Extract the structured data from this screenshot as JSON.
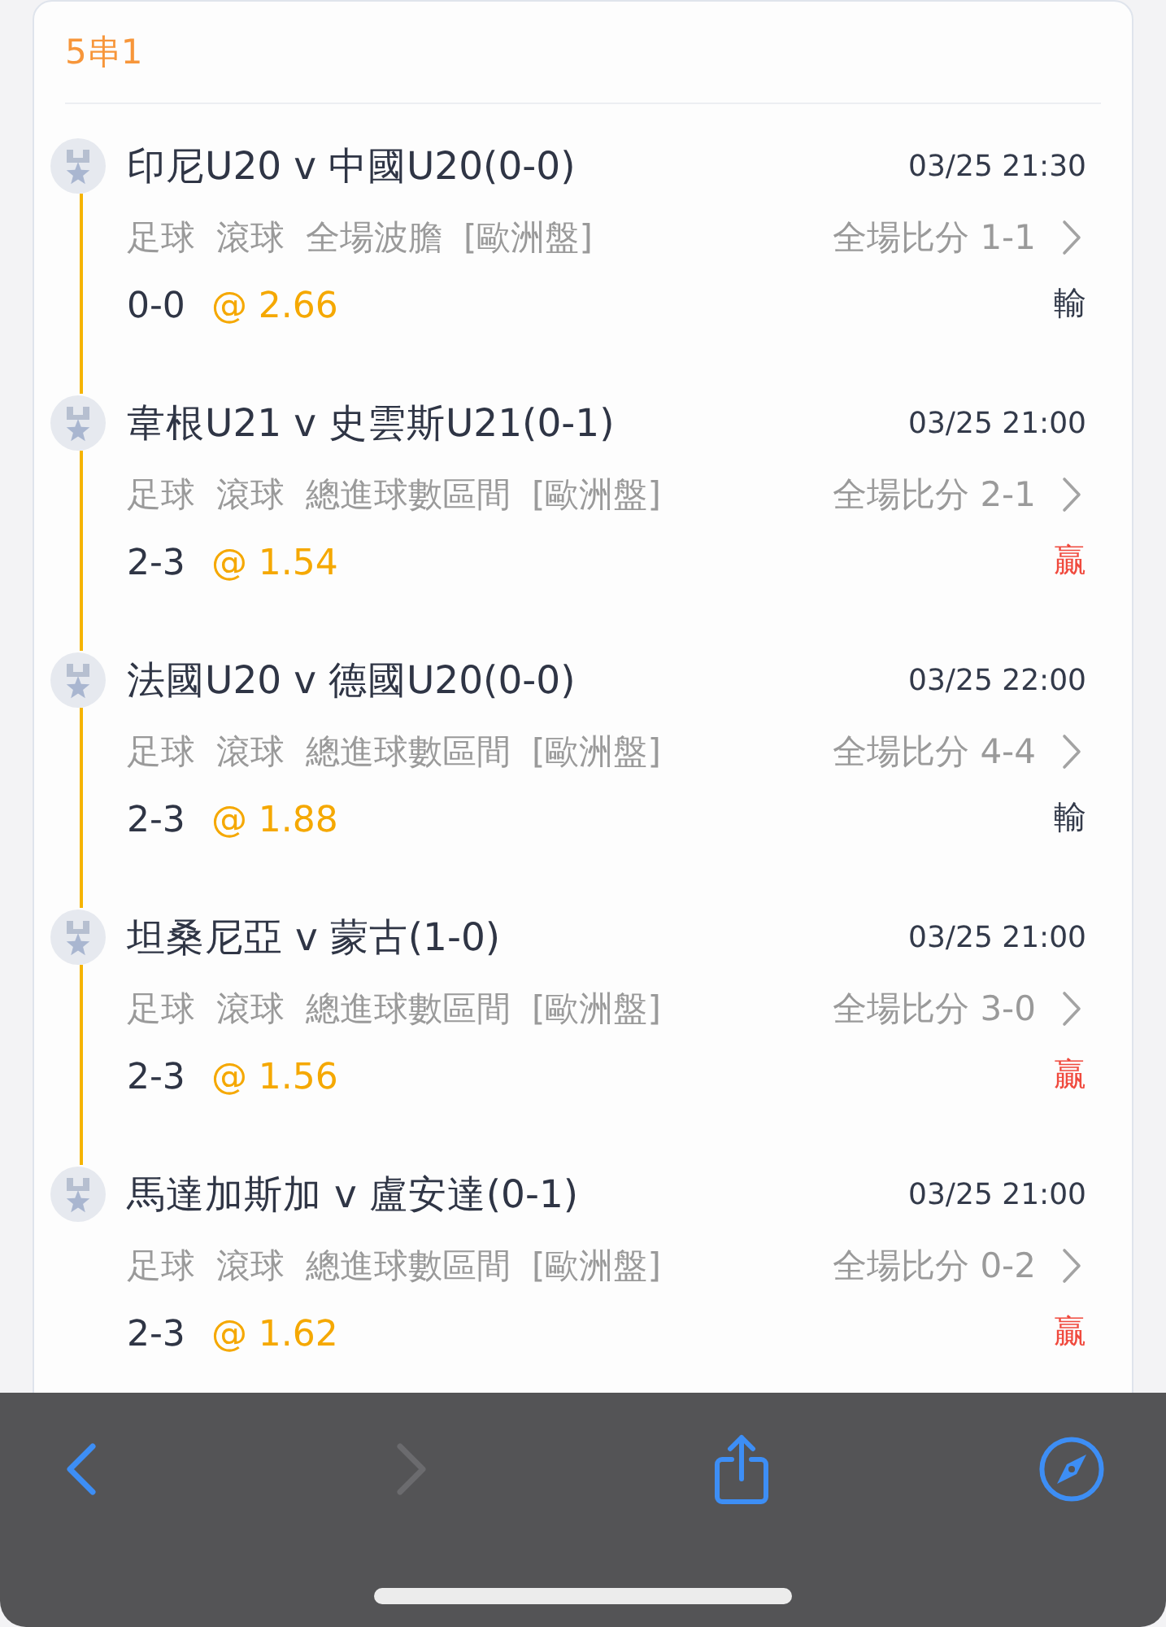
{
  "bet": {
    "title": "5串1"
  },
  "selections": [
    {
      "match": "印尼U20 v 中國U20(0-0)",
      "time": "03/25 21:30",
      "tags": [
        "足球",
        "滾球",
        "全場波膽",
        "[歐洲盤]"
      ],
      "score_label": "全場比分 1-1",
      "pick": "0-0",
      "odds": "@ 2.66",
      "result": "輸",
      "kind": "lose"
    },
    {
      "match": "韋根U21 v 史雲斯U21(0-1)",
      "time": "03/25 21:00",
      "tags": [
        "足球",
        "滾球",
        "總進球數區間",
        "[歐洲盤]"
      ],
      "score_label": "全場比分 2-1",
      "pick": "2-3",
      "odds": "@ 1.54",
      "result": "贏",
      "kind": "win"
    },
    {
      "match": "法國U20 v 德國U20(0-0)",
      "time": "03/25 22:00",
      "tags": [
        "足球",
        "滾球",
        "總進球數區間",
        "[歐洲盤]"
      ],
      "score_label": "全場比分 4-4",
      "pick": "2-3",
      "odds": "@ 1.88",
      "result": "輸",
      "kind": "lose"
    },
    {
      "match": "坦桑尼亞 v 蒙古(1-0)",
      "time": "03/25 21:00",
      "tags": [
        "足球",
        "滾球",
        "總進球數區間",
        "[歐洲盤]"
      ],
      "score_label": "全場比分 3-0",
      "pick": "2-3",
      "odds": "@ 1.56",
      "result": "贏",
      "kind": "win"
    },
    {
      "match": "馬達加斯加 v 盧安達(0-1)",
      "time": "03/25 21:00",
      "tags": [
        "足球",
        "滾球",
        "總進球數區間",
        "[歐洲盤]"
      ],
      "score_label": "全場比分 0-2",
      "pick": "2-3",
      "odds": "@ 1.62",
      "result": "贏",
      "kind": "win"
    }
  ],
  "toolbar": {
    "buttons": [
      {
        "kind": "back",
        "disabled": false
      },
      {
        "kind": "forward",
        "disabled": true
      },
      {
        "kind": "share",
        "disabled": false
      },
      {
        "kind": "compass",
        "disabled": false
      }
    ]
  }
}
